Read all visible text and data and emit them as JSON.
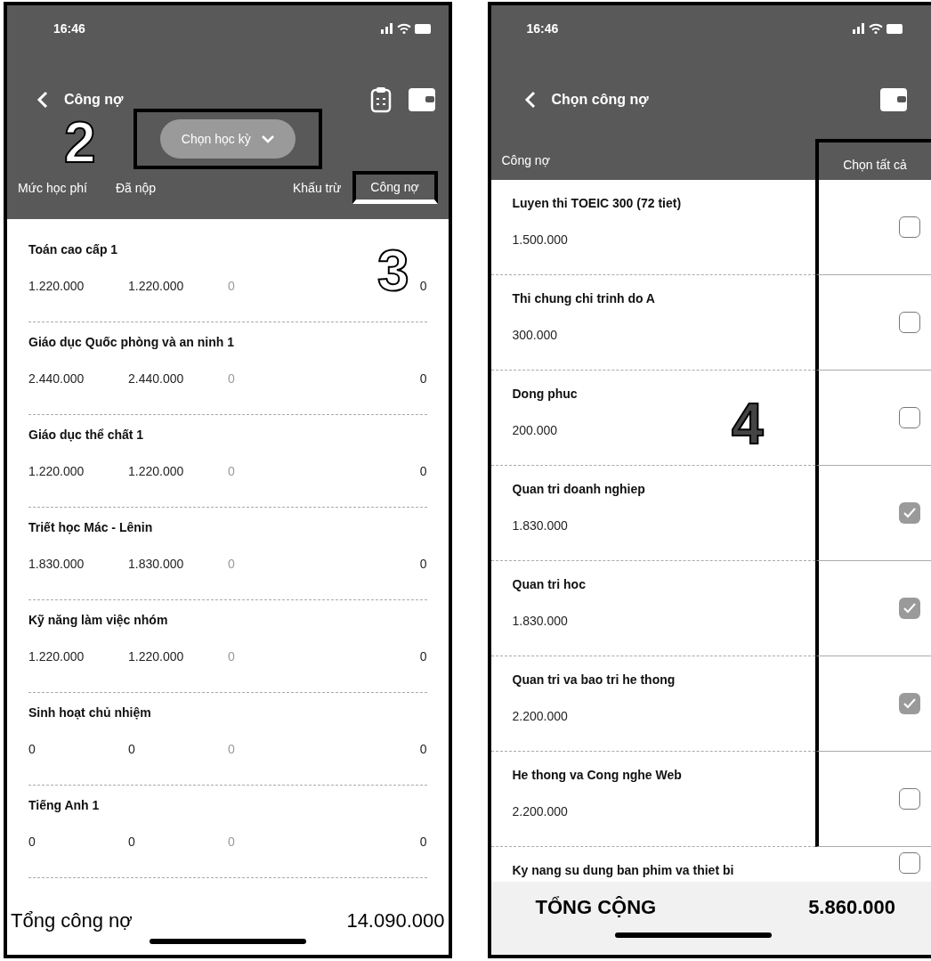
{
  "left_screen": {
    "status_bar": {
      "time": "16:46"
    },
    "nav": {
      "title": "Công nợ"
    },
    "semester_picker": {
      "label": "Chọn học kỳ"
    },
    "columns": [
      {
        "label": "Mức học phí",
        "selected": false
      },
      {
        "label": "Đã nộp",
        "selected": false
      },
      {
        "label": "Khấu trừ",
        "selected": false
      },
      {
        "label": "Công nợ",
        "selected": true
      }
    ],
    "items": [
      {
        "name": "Toán cao cấp 1",
        "values": [
          "1.220.000",
          "1.220.000",
          "0",
          "0"
        ]
      },
      {
        "name": "Giáo dục Quốc phòng và an ninh 1",
        "values": [
          "2.440.000",
          "2.440.000",
          "0",
          "0"
        ]
      },
      {
        "name": "Giáo dục thể chất 1",
        "values": [
          "1.220.000",
          "1.220.000",
          "0",
          "0"
        ]
      },
      {
        "name": "Triết học Mác - Lênin",
        "values": [
          "1.830.000",
          "1.830.000",
          "0",
          "0"
        ]
      },
      {
        "name": "Kỹ năng làm việc nhóm",
        "values": [
          "1.220.000",
          "1.220.000",
          "0",
          "0"
        ]
      },
      {
        "name": "Sinh hoạt chủ nhiệm",
        "values": [
          "0",
          "0",
          "0",
          "0"
        ]
      },
      {
        "name": "Tiếng Anh 1",
        "values": [
          "0",
          "0",
          "0",
          "0"
        ]
      }
    ],
    "total": {
      "label": "Tổng công nợ",
      "value": "14.090.000"
    }
  },
  "right_screen": {
    "status_bar": {
      "time": "16:46"
    },
    "nav": {
      "title": "Chọn công nợ"
    },
    "header": {
      "label": "Công nợ",
      "select_all": "Chọn tất cả"
    },
    "items": [
      {
        "name": "Luyen thi TOEIC 300 (72 tiet)",
        "amount": "1.500.000",
        "checked": false
      },
      {
        "name": "Thi chung chi trinh do A",
        "amount": "300.000",
        "checked": false
      },
      {
        "name": "Dong phuc",
        "amount": "200.000",
        "checked": false
      },
      {
        "name": "Quan tri doanh nghiep",
        "amount": "1.830.000",
        "checked": true
      },
      {
        "name": "Quan tri hoc",
        "amount": "1.830.000",
        "checked": true
      },
      {
        "name": "Quan tri va bao tri he thong",
        "amount": "2.200.000",
        "checked": true
      },
      {
        "name": "He thong va Cong nghe Web",
        "amount": "2.200.000",
        "checked": false
      },
      {
        "name": "Ky nang su dung ban phim va thiet bi",
        "checked": false
      }
    ],
    "total": {
      "label": "TỔNG CỘNG",
      "value": "5.860.000"
    }
  },
  "annotations": [
    {
      "label": "2"
    },
    {
      "label": "3"
    },
    {
      "label": "4"
    }
  ]
}
